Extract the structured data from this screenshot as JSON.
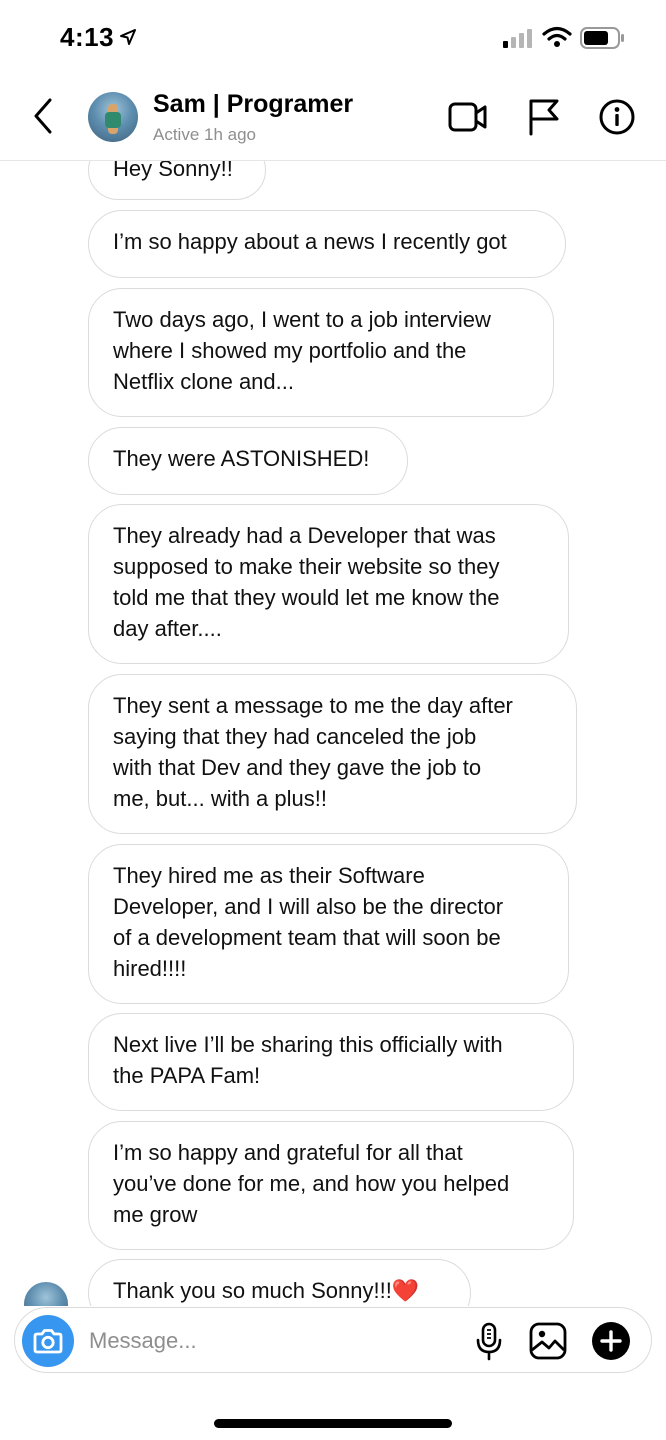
{
  "status_bar": {
    "time": "4:13"
  },
  "header": {
    "contact_name": "Sam | Programer",
    "status": "Active 1h ago"
  },
  "messages": [
    "Hey Sonny!!",
    "I’m so happy about a news I recently got",
    "Two days ago, I went to a job interview\nwhere I showed my portfolio and the\nNetflix clone and...",
    "They were ASTONISHED!",
    "They already had a Developer that was\nsupposed to make their website so they\ntold me that they would let me know the\nday after....",
    "They sent a message to me the day after\nsaying that they had canceled the job\nwith that Dev and they gave the job to\nme, but... with a plus!!",
    "They hired me as their Software\nDeveloper, and I will also be the director\nof a development team that will soon be\nhired!!!!",
    "Next live I’ll be sharing this officially with\nthe PAPA Fam!",
    "I’m so happy and grateful for all that\nyou’ve done for me, and how you helped\nme grow",
    "Thank you so much Sonny!!!❤️"
  ],
  "composer": {
    "placeholder": "Message..."
  },
  "icons": {
    "back": "chevron-left-icon",
    "video": "video-camera-icon",
    "report": "flag-icon",
    "info": "info-icon",
    "camera": "camera-icon",
    "mic": "microphone-icon",
    "gallery": "image-icon",
    "add": "plus-circle-icon"
  },
  "colors": {
    "accent": "#3797f0",
    "muted": "#8e8e8e",
    "border": "#dbdbdb"
  }
}
